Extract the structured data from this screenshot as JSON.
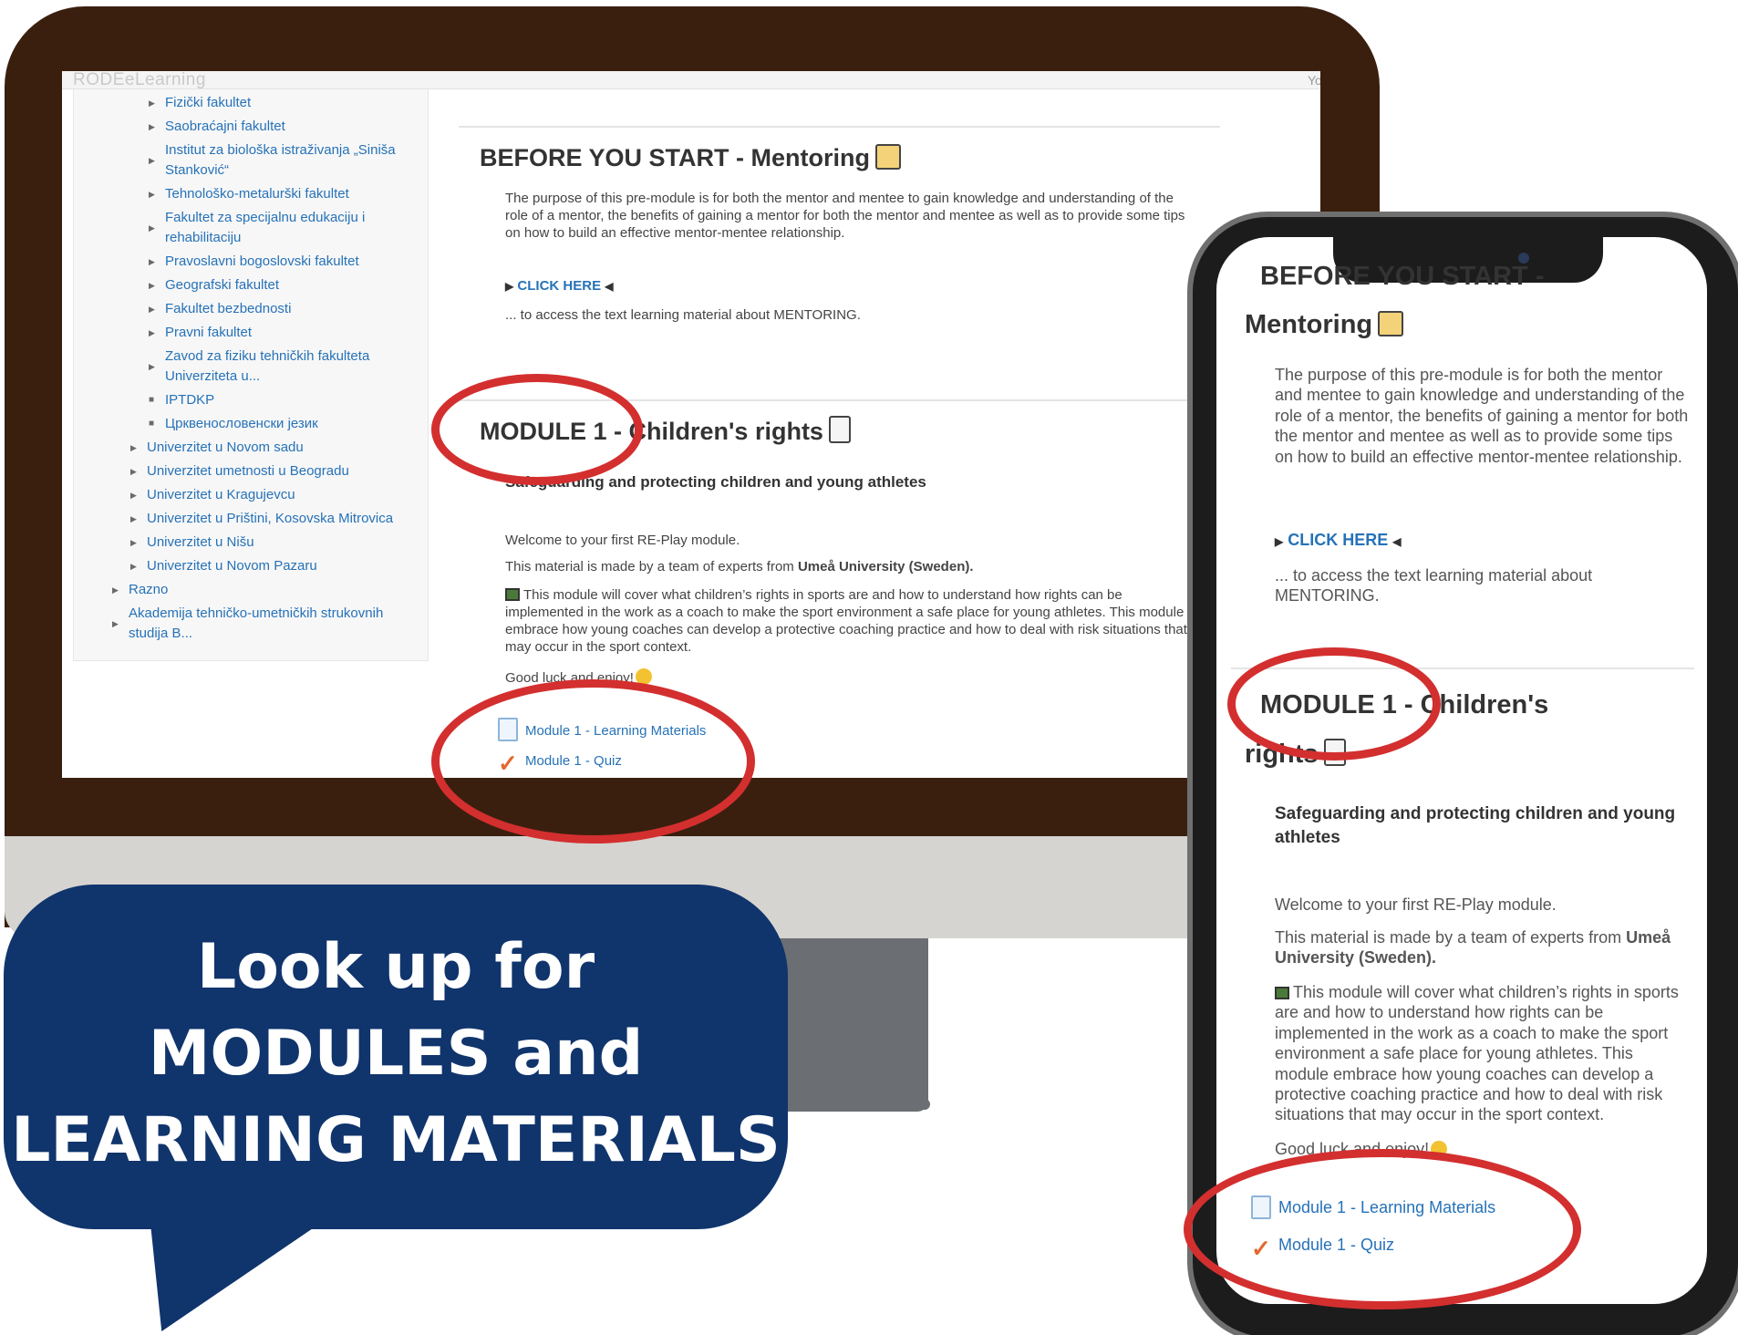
{
  "desktop": {
    "site_name": "RODEeLearning",
    "user_corner": "Yo",
    "tree": [
      {
        "label": "Fizički fakultet",
        "marker": "triangle"
      },
      {
        "label": "Saobraćajni fakultet",
        "marker": "triangle"
      },
      {
        "label": "Institut za biološka istraživanja „Siniša Stanković“",
        "marker": "triangle"
      },
      {
        "label": "Tehnološko-metalurški fakultet",
        "marker": "triangle"
      },
      {
        "label": "Fakultet za specijalnu edukaciju i rehabilitaciju",
        "marker": "triangle"
      },
      {
        "label": "Pravoslavni bogoslovski fakultet",
        "marker": "triangle"
      },
      {
        "label": "Geografski fakultet",
        "marker": "triangle"
      },
      {
        "label": "Fakultet bezbednosti",
        "marker": "triangle"
      },
      {
        "label": "Pravni fakultet",
        "marker": "triangle"
      },
      {
        "label": "Zavod za fiziku tehničkih fakulteta Univerziteta u...",
        "marker": "triangle"
      },
      {
        "label": "IPTDKP",
        "marker": "square"
      },
      {
        "label": "Црквенословенски језик",
        "marker": "square"
      },
      {
        "label": "Univerzitet u Novom sadu",
        "marker": "triangle"
      },
      {
        "label": "Univerzitet umetnosti u Beogradu",
        "marker": "triangle"
      },
      {
        "label": "Univerzitet u Kragujevcu",
        "marker": "triangle"
      },
      {
        "label": "Univerzitet u Prištini, Kosovska Mitrovica",
        "marker": "triangle"
      },
      {
        "label": "Univerzitet u Nišu",
        "marker": "triangle"
      },
      {
        "label": "Univerzitet u Novom Pazaru",
        "marker": "triangle"
      },
      {
        "label": "Razno",
        "marker": "triangle"
      },
      {
        "label": "Akademija tehničko-umetničkih strukovnih studija B...",
        "marker": "triangle"
      }
    ],
    "before_title": "BEFORE YOU START - Mentoring",
    "before_text": "The purpose of this pre-module is for both the mentor and mentee to gain knowledge and understanding of the role of a mentor, the benefits of gaining a mentor for both the mentor and mentee as well as to provide some tips on how to build an effective mentor-mentee relationship.",
    "click_here": "CLICK HERE",
    "click_here_after": "... to access the text learning material about MENTORING.",
    "module_title": "MODULE 1 - Children's rights",
    "module_sub": "Safeguarding and protecting children and young athletes",
    "welcome": "Welcome to your first RE-Play module.",
    "made_by_prefix": "This material is made by a team of experts from ",
    "made_by_bold": "Umeå University (Sweden).",
    "cover_text": "This module will cover what children’s rights in sports are and how to understand how rights can be implemented in the work as a coach to make the sport environment a safe place for young athletes. This module embrace how young coaches can develop a protective coaching practice and how to deal with risk situations that may occur in the sport context.",
    "good_luck": "Good luck and enjoy!",
    "activity_materials": "Module 1 - Learning Materials",
    "activity_quiz": "Module 1 - Quiz"
  },
  "mobile": {
    "title_line1": "BEFORE YOU START -",
    "title_line2": "Mentoring",
    "before_text": "The purpose of this pre-module is for both the mentor and mentee to gain knowledge and understanding of the role of a mentor, the benefits of gaining a mentor for both the mentor and mentee as well as to provide some tips on how to build an effective mentor-mentee relationship.",
    "click_here": "CLICK HERE",
    "click_here_after": "... to access the text learning material about MENTORING.",
    "module_title_line1": "MODULE 1 - Children's",
    "module_title_line2": "rights",
    "module_sub": "Safeguarding and protecting children and young athletes",
    "welcome": "Welcome to your first RE-Play module.",
    "made_by_prefix": "This material is made by a team of experts from ",
    "made_by_bold": "Umeå University (Sweden).",
    "cover_text": "This module will cover what children’s rights in sports are and how to understand how rights can be implemented in the work as a coach to make the sport environment a safe place for young athletes. This module embrace how young coaches can develop a protective coaching practice and how to deal with risk situations that may occur in the sport context.",
    "good_luck": "Good luck and enjoy!",
    "activity_materials": "Module 1 - Learning Materials",
    "activity_quiz": "Module 1 - Quiz"
  },
  "bubble": {
    "line1": "Look up for",
    "line2": "MODULES and",
    "line3": "LEARNING MATERIALS"
  },
  "colors": {
    "monitor_bezel": "#3a1f0f",
    "link_blue": "#2672b8",
    "highlight_red": "#d32f2f",
    "bubble_navy": "#10346c"
  }
}
